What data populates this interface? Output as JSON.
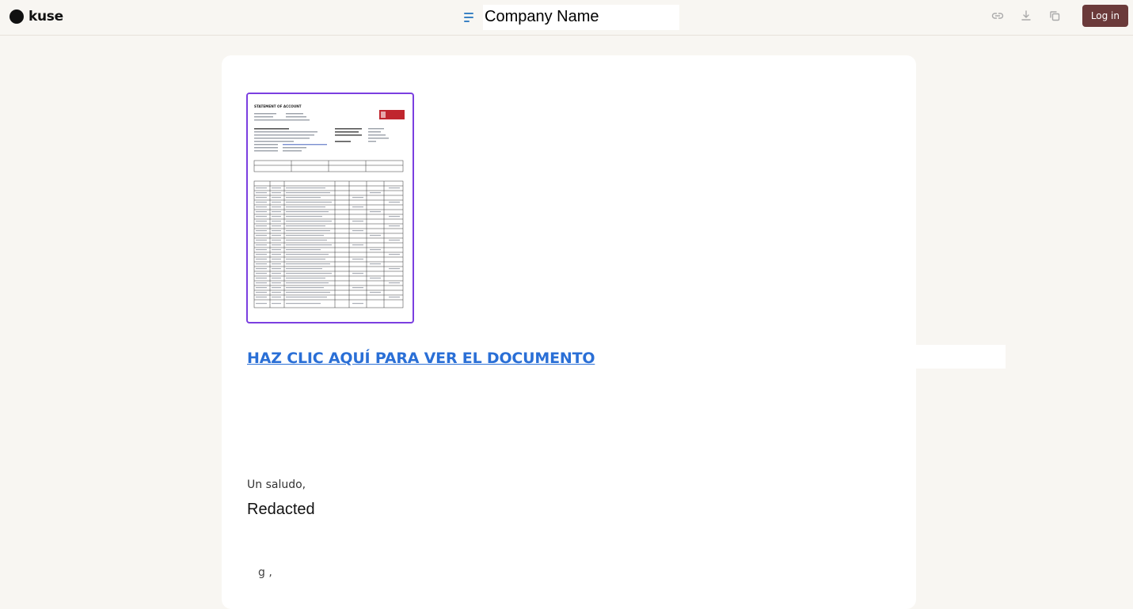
{
  "header": {
    "brand": "kuse",
    "doc_title": "Company Name",
    "login_label": "Log in",
    "icons": [
      "menu-lines-icon",
      "link-icon",
      "download-icon",
      "copy-icon"
    ],
    "accent": "#3b82c4",
    "login_color": "#6b3a3a"
  },
  "document": {
    "thumbnail": {
      "heading": "STATEMENT OF ACCOUNT",
      "border_color": "#7b3fe0"
    },
    "link_text": "HAZ CLIC AQUÍ PARA VER EL DOCUMENTO",
    "link_color": "#2a6fd6",
    "greeting": "Un saludo,",
    "signature": "Redacted",
    "cut_text": "g ,"
  }
}
